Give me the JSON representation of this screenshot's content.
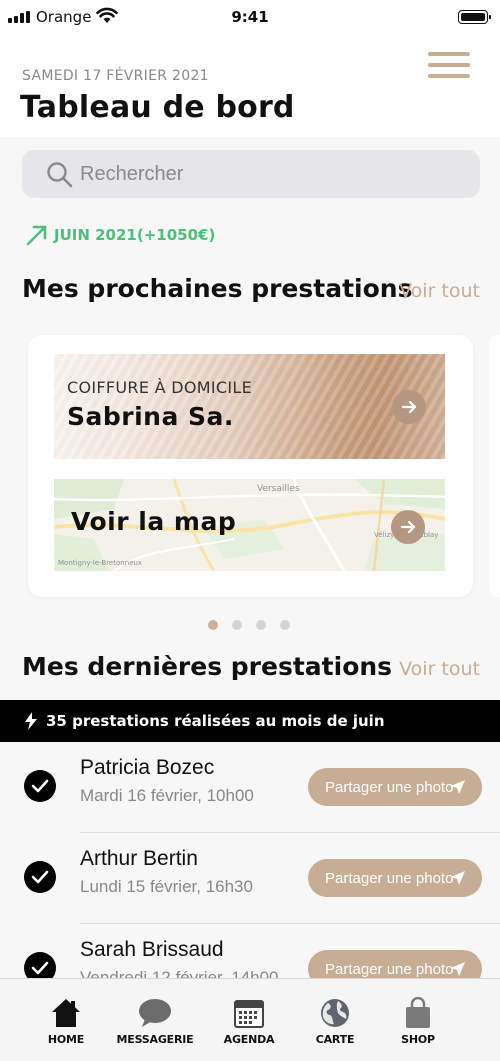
{
  "status_bar": {
    "carrier": "Orange",
    "time": "9:41"
  },
  "header": {
    "date": "SAMEDI 17 FÉVRIER 2021",
    "title": "Tableau de bord"
  },
  "search": {
    "placeholder": "Rechercher"
  },
  "trend": {
    "text": "JUIN 2021(+1050€)",
    "color": "#4cbf7a"
  },
  "upcoming": {
    "title": "Mes prochaines prestations",
    "see_all": "Voir tout",
    "card": {
      "service": "COIFFURE À DOMICILE",
      "client": "Sabrina Sa.",
      "map_label": "Voir la map",
      "map_places": [
        "Versailles",
        "Vélizy-Villacoublay",
        "Montigny-le-Bretonneux"
      ]
    },
    "pagination": {
      "count": 4,
      "active": 1
    }
  },
  "recent": {
    "title": "Mes dernières prestations",
    "see_all": "Voir tout",
    "banner": "35 prestations réalisées au mois de juin",
    "items": [
      {
        "name": "Patricia Bozec",
        "date": "Mardi 16 février, 10h00",
        "action": "Partager une photo"
      },
      {
        "name": "Arthur Bertin",
        "date": "Lundi 15 février, 16h30",
        "action": "Partager une photo"
      },
      {
        "name": "Sarah Brissaud",
        "date": "Vendredi 12 février, 14h00",
        "action": "Partager une photo"
      }
    ]
  },
  "nav": {
    "items": [
      {
        "label": "HOME",
        "icon": "home-icon"
      },
      {
        "label": "MESSAGERIE",
        "icon": "chat-bubble-icon"
      },
      {
        "label": "AGENDA",
        "icon": "calendar-icon"
      },
      {
        "label": "CARTE",
        "icon": "globe-icon"
      },
      {
        "label": "SHOP",
        "icon": "shopping-bag-icon"
      }
    ]
  },
  "colors": {
    "accent": "#c8ad95",
    "trend_green": "#4cbf7a",
    "banner_bg": "#000000"
  }
}
